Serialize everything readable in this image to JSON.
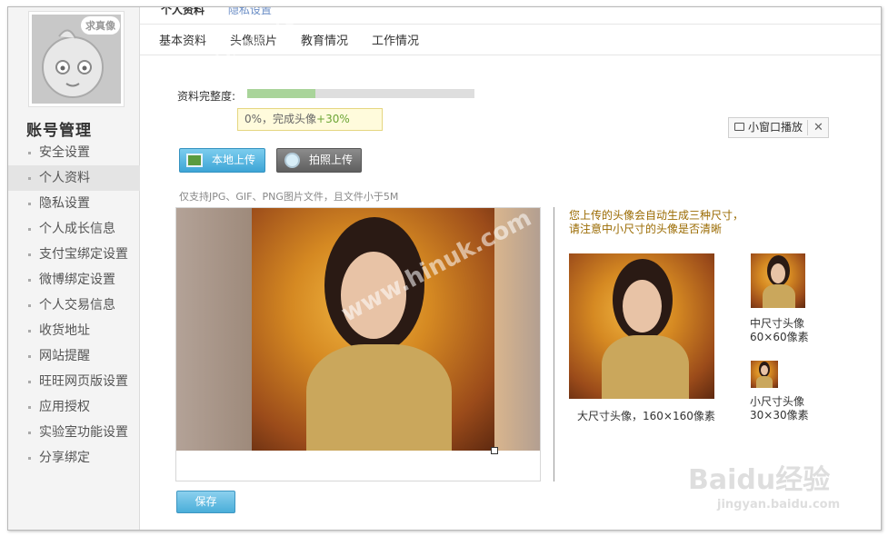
{
  "avatar": {
    "badge": "求真像"
  },
  "sidebar": {
    "title": "账号管理",
    "items": [
      {
        "label": "安全设置"
      },
      {
        "label": "个人资料",
        "active": true
      },
      {
        "label": "隐私设置"
      },
      {
        "label": "个人成长信息"
      },
      {
        "label": "支付宝绑定设置"
      },
      {
        "label": "微博绑定设置"
      },
      {
        "label": "个人交易信息"
      },
      {
        "label": "收货地址"
      },
      {
        "label": "网站提醒"
      },
      {
        "label": "旺旺网页版设置"
      },
      {
        "label": "应用授权"
      },
      {
        "label": "实验室功能设置"
      },
      {
        "label": "分享绑定"
      }
    ]
  },
  "top_tabs": {
    "primary": "个人资料",
    "secondary": "隐私设置"
  },
  "subtabs": [
    "基本资料",
    "头像照片",
    "教育情况",
    "工作情况"
  ],
  "completeness": {
    "label": "资料完整度:",
    "progress": 0.3,
    "tip_prefix": "0%，完成头像",
    "tip_gain": "+30%"
  },
  "mini_player": {
    "label": "小窗口播放",
    "close": "✕"
  },
  "upload": {
    "local_label": "本地上传",
    "photo_label": "拍照上传",
    "support_text": "仅支持JPG、GIF、PNG图片文件，且文件小于5M"
  },
  "preview": {
    "note_line1": "您上传的头像会自动生成三种尺寸，",
    "note_line2": "请注意中小尺寸的头像是否清晰",
    "large_caption": "大尺寸头像，160×160像素",
    "mid_caption_1": "中尺寸头像",
    "mid_caption_2": "60×60像素",
    "small_caption_1": "小尺寸头像",
    "small_caption_2": "30×30像素"
  },
  "save_label": "保存",
  "watermarks": {
    "site": "www.hinuk.com",
    "brand": "Baidu经验",
    "sub": "jingyan.baidu.com"
  },
  "colors": {
    "accent": "#3da5d6",
    "progress": "#a9d49a",
    "note": "#9a6a00"
  }
}
